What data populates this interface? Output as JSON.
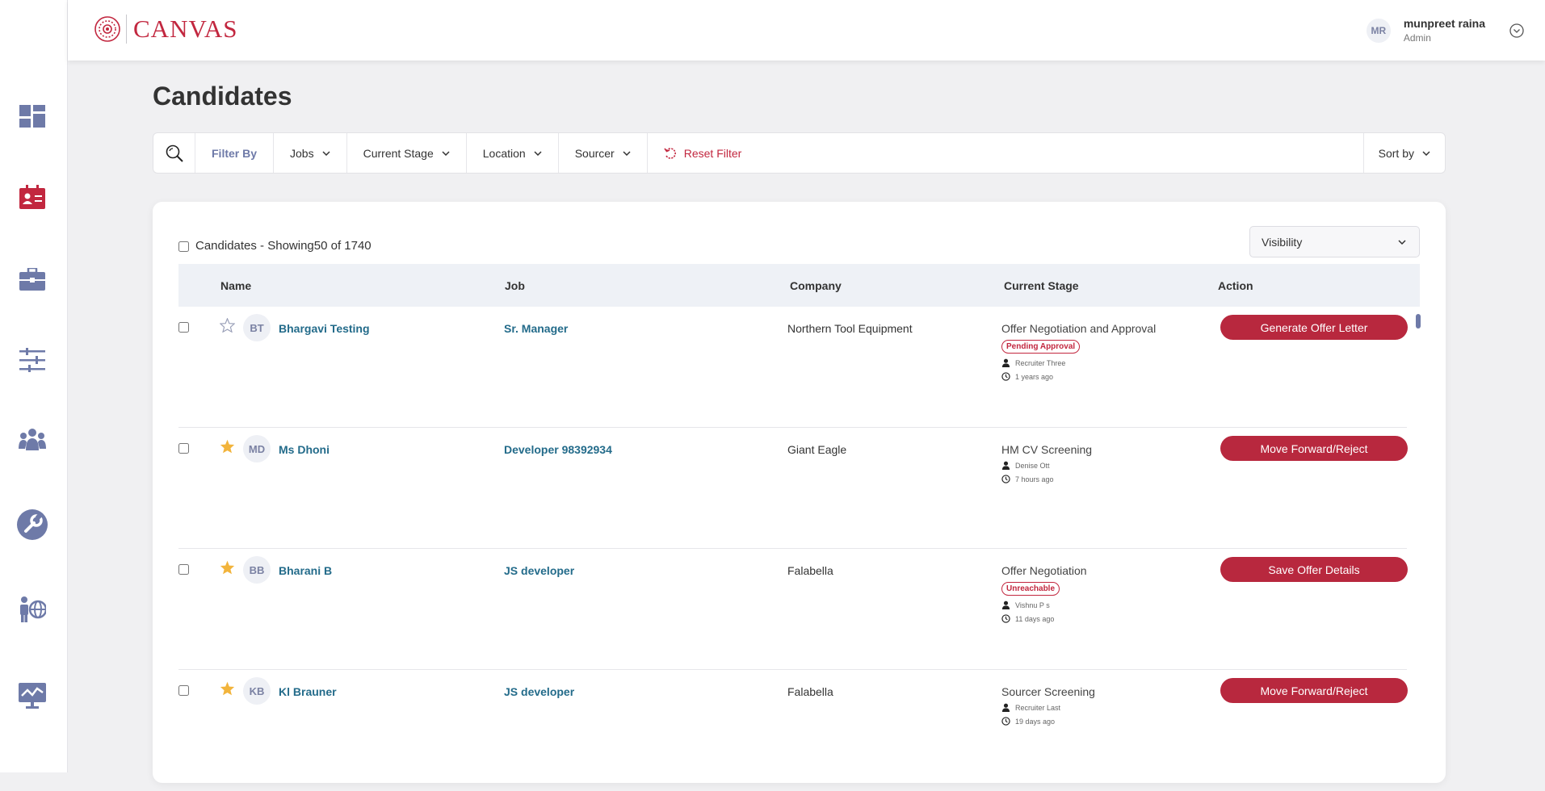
{
  "app": {
    "logo_text": "CANVAS",
    "brand_color": "#c2273f"
  },
  "sidebar": {
    "items": [
      {
        "icon": "dashboard-icon",
        "active": false
      },
      {
        "icon": "candidates-card-icon",
        "active": true
      },
      {
        "icon": "briefcase-icon",
        "active": false
      },
      {
        "icon": "sliders-icon",
        "active": false
      },
      {
        "icon": "team-icon",
        "active": false
      },
      {
        "icon": "tools-icon",
        "active": false
      },
      {
        "icon": "global-people-icon",
        "active": false
      },
      {
        "icon": "analytics-monitor-icon",
        "active": false
      }
    ]
  },
  "user": {
    "initials": "MR",
    "name": "munpreet raina",
    "role": "Admin"
  },
  "page": {
    "title": "Candidates"
  },
  "filters": {
    "filter_by": "Filter By",
    "jobs": "Jobs",
    "current_stage": "Current Stage",
    "location": "Location",
    "sourcer": "Sourcer",
    "reset": "Reset Filter",
    "sort_by": "Sort by"
  },
  "list": {
    "showing_text": "Candidates - Showing50 of 1740",
    "visibility_label": "Visibility",
    "columns": [
      "Name",
      "Job",
      "Company",
      "Current Stage",
      "Action"
    ],
    "rows": [
      {
        "starred": false,
        "initials": "BT",
        "name": "Bhargavi Testing",
        "job": "Sr. Manager",
        "company": "Northern Tool Equipment",
        "stage": "Offer Negotiation and Approval",
        "badge": "Pending Approval",
        "owner": "Recruiter Three",
        "time": "1 years ago",
        "action": "Generate Offer Letter"
      },
      {
        "starred": true,
        "initials": "MD",
        "name": "Ms Dhoni",
        "job": "Developer 98392934",
        "company": "Giant Eagle",
        "stage": "HM CV Screening",
        "badge": "",
        "owner": "Denise Ott",
        "time": "7 hours ago",
        "action": "Move Forward/Reject"
      },
      {
        "starred": true,
        "initials": "BB",
        "name": "Bharani B",
        "job": "JS developer",
        "company": "Falabella",
        "stage": "Offer Negotiation",
        "badge": "Unreachable",
        "owner": "Vishnu P s",
        "time": "11 days ago",
        "action": "Save Offer Details"
      },
      {
        "starred": true,
        "initials": "KB",
        "name": "Kl Brauner",
        "job": "JS developer",
        "company": "Falabella",
        "stage": "Sourcer Screening",
        "badge": "",
        "owner": "Recruiter Last",
        "time": "19 days ago",
        "action": "Move Forward/Reject"
      }
    ]
  }
}
